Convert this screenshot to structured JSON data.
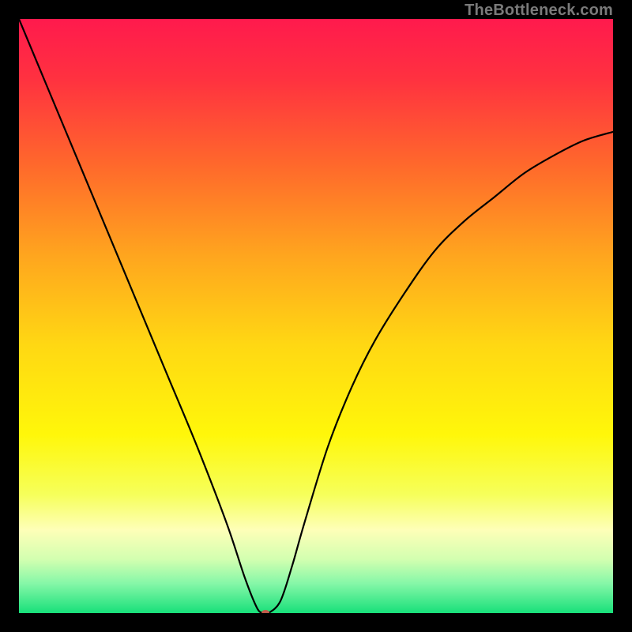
{
  "attribution": "TheBottleneck.com",
  "chart_data": {
    "type": "line",
    "title": "",
    "xlabel": "",
    "ylabel": "",
    "xlim": [
      0,
      100
    ],
    "ylim": [
      0,
      100
    ],
    "grid": false,
    "legend": false,
    "background": {
      "description": "vertical gradient red→orange→yellow→pale→green with thin black border",
      "stops": [
        {
          "pos": 0.0,
          "color": "#ff1a4d"
        },
        {
          "pos": 0.1,
          "color": "#ff3140"
        },
        {
          "pos": 0.25,
          "color": "#ff6a2b"
        },
        {
          "pos": 0.4,
          "color": "#ffa61e"
        },
        {
          "pos": 0.55,
          "color": "#ffd813"
        },
        {
          "pos": 0.7,
          "color": "#fff70a"
        },
        {
          "pos": 0.8,
          "color": "#f6ff5a"
        },
        {
          "pos": 0.86,
          "color": "#feffb8"
        },
        {
          "pos": 0.91,
          "color": "#d2ffb0"
        },
        {
          "pos": 0.95,
          "color": "#86f7a8"
        },
        {
          "pos": 1.0,
          "color": "#18e07a"
        }
      ]
    },
    "series": [
      {
        "name": "bottleneck-curve",
        "color": "#000000",
        "width": 2.2,
        "x": [
          0,
          5,
          10,
          15,
          20,
          25,
          30,
          35,
          38,
          40,
          41,
          42,
          44,
          46,
          48,
          52,
          56,
          60,
          65,
          70,
          75,
          80,
          85,
          90,
          95,
          100
        ],
        "values": [
          100,
          88,
          76,
          64,
          52,
          40,
          28,
          15,
          6,
          1,
          0,
          0,
          2,
          8,
          15,
          28,
          38,
          46,
          54,
          61,
          66,
          70,
          74,
          77,
          79.5,
          81
        ]
      }
    ],
    "marker": {
      "name": "minimum-point",
      "x": 41.5,
      "y": 0,
      "color": "#c15a4a",
      "rx": 5,
      "ry": 4
    }
  }
}
